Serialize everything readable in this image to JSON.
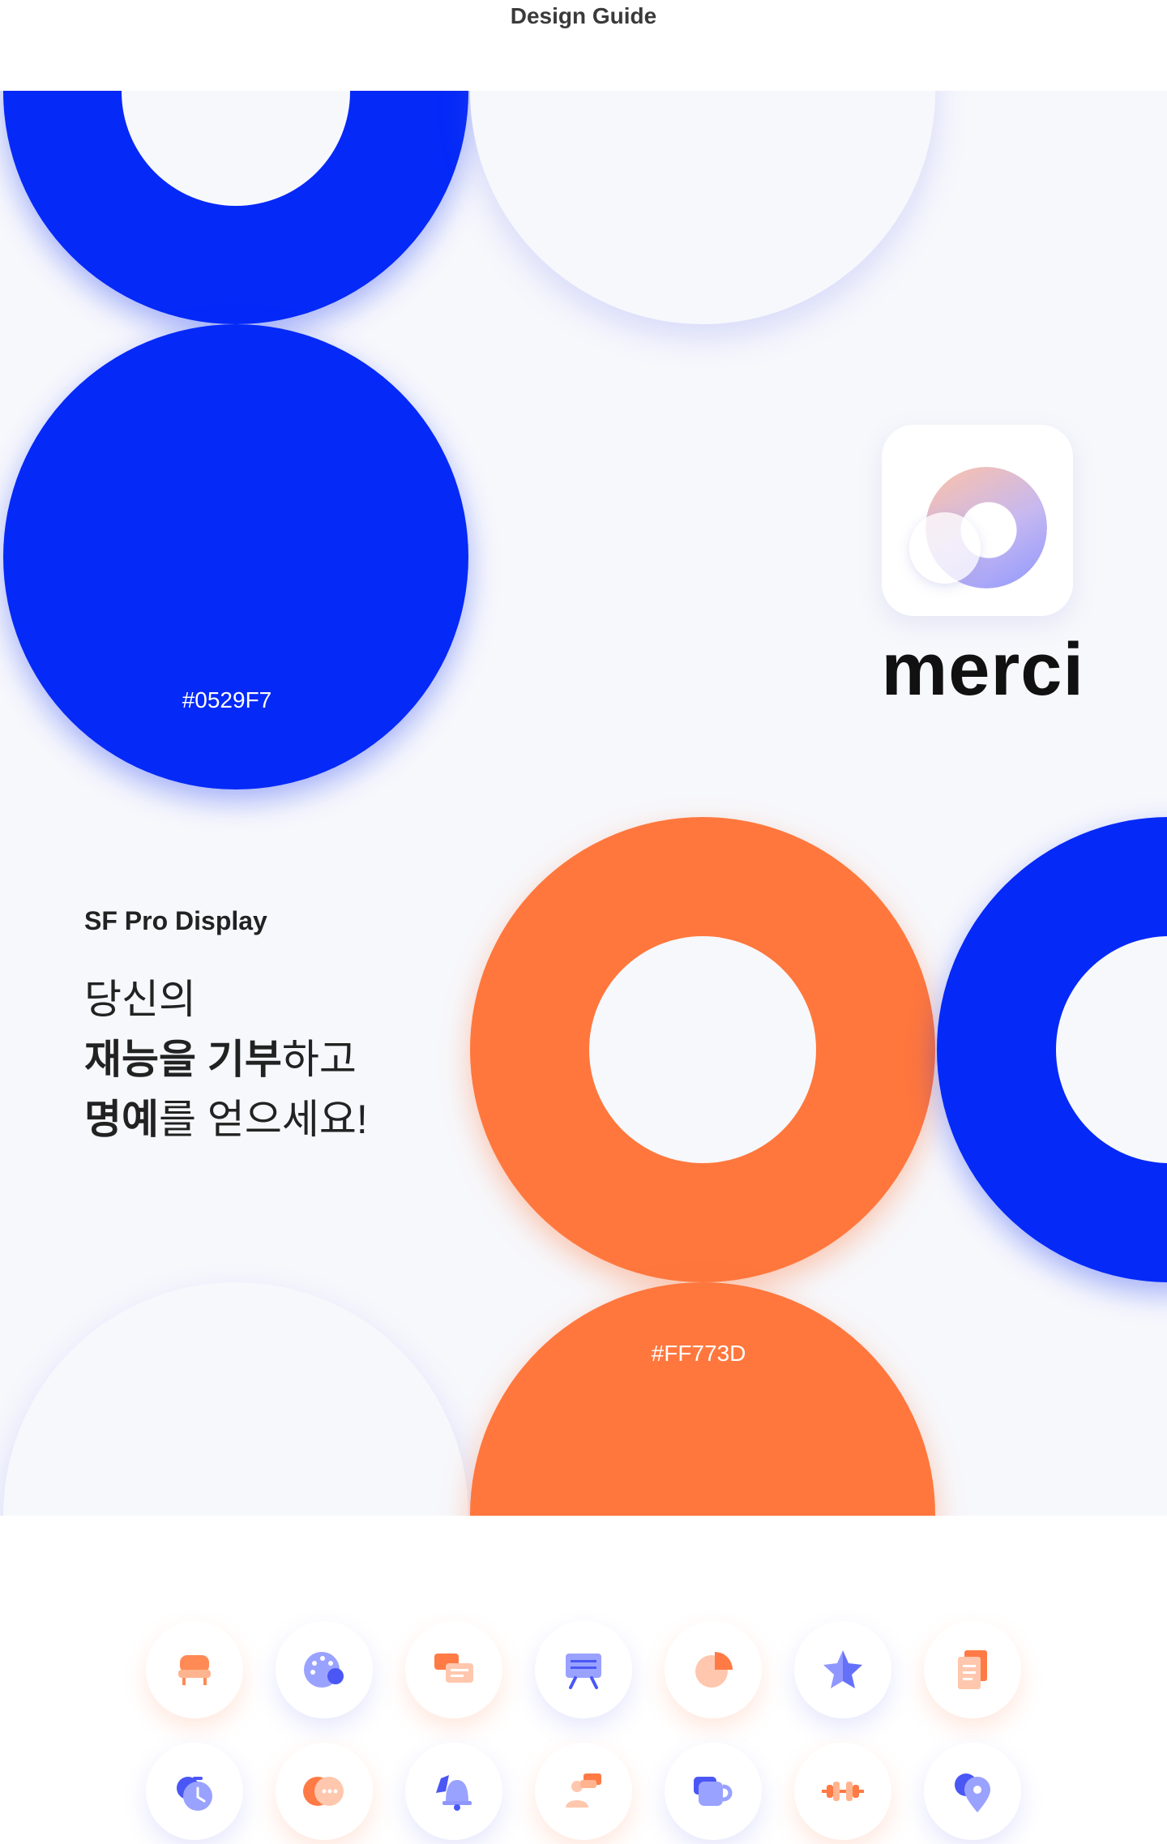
{
  "header": {
    "title": "Design Guide"
  },
  "colors": {
    "primary_blue": "#0529F7",
    "accent_orange": "#FF773D",
    "background": "#f7f8fc",
    "icon_periwinkle": "#8f97ff",
    "icon_peach": "#ffc2a6"
  },
  "swatches": {
    "blue_label": "#0529F7",
    "orange_label": "#FF773D"
  },
  "brand": {
    "name": "merci"
  },
  "typography": {
    "font_name": "SF Pro Display",
    "tagline_line1": "당신의",
    "tagline_line2_bold": "재능을 기부",
    "tagline_line2_rest": "하고",
    "tagline_line3_bold": "명예",
    "tagline_line3_rest": "를 얻으세요!"
  },
  "icons": {
    "row1": [
      "armchair-icon",
      "palette-icon",
      "chat-bubbles-icon",
      "presentation-board-icon",
      "pie-chart-icon",
      "star-icon",
      "clipboard-icon"
    ],
    "row2": [
      "stopwatch-icon",
      "message-dots-icon",
      "bell-icon",
      "person-message-icon",
      "coffee-cup-icon",
      "dumbbell-icon",
      "location-pin-icon"
    ]
  }
}
